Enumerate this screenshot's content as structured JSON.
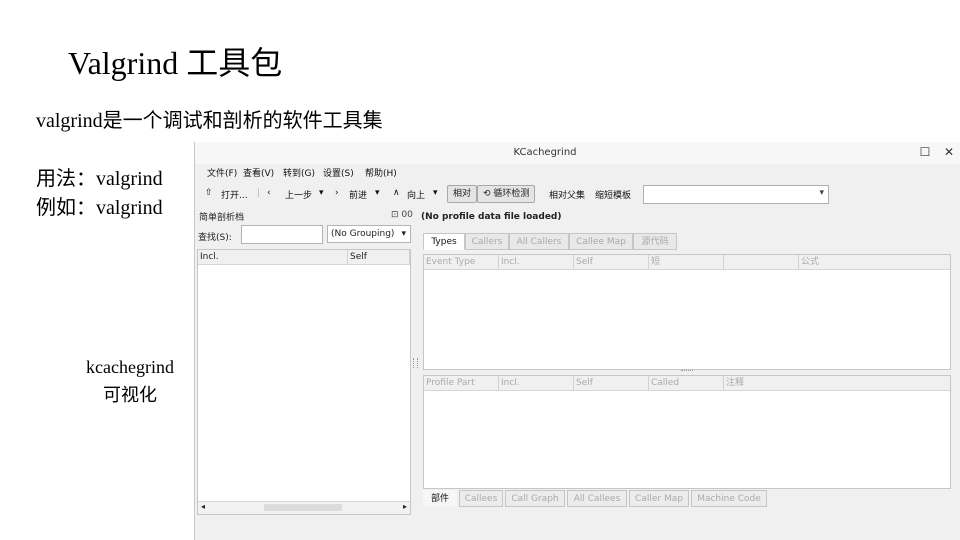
{
  "slide": {
    "title": "Valgrind 工具包",
    "intro": "valgrind是一个调试和剖析的软件工具集",
    "usage": "用法：valgrind",
    "example": "例如：valgrind",
    "caption_line1": "kcachegrind",
    "caption_line2": "可视化"
  },
  "window": {
    "title": "KCachegrind",
    "maximize_glyph": "☐",
    "close_glyph": "✕"
  },
  "menu": [
    "文件(F)",
    "查看(V)",
    "转到(G)",
    "设置(S)",
    "帮助(H)"
  ],
  "toolbar": {
    "open": "打开...",
    "back": "上一步",
    "forward": "前进",
    "up": "向上",
    "relative": "相对",
    "cycle_detection": "循环检测",
    "relative_to_parent": "相对父集",
    "shorten_templates": "缩短模板",
    "event_select": ""
  },
  "left_panel": {
    "title": "简单剖析档",
    "title_right": "⊡ 00",
    "search_label": "查找(S):",
    "search_value": "",
    "grouping": "(No Grouping)",
    "columns": [
      "Incl.",
      "Self"
    ]
  },
  "right_panel": {
    "status": "(No profile data file loaded)",
    "top_tabs": [
      {
        "label": "Types",
        "active": true
      },
      {
        "label": "Callers",
        "active": false
      },
      {
        "label": "All Callers",
        "active": false
      },
      {
        "label": "Callee Map",
        "active": false
      },
      {
        "label": "源代码",
        "active": false
      }
    ],
    "top_columns": [
      "Event Type",
      "Incl.",
      "Self",
      "短",
      "",
      "公式"
    ],
    "bottom_columns": [
      "Profile Part",
      "Incl.",
      "Self",
      "Called",
      "注释"
    ],
    "bottom_tabs": [
      {
        "label": "部件",
        "active": true
      },
      {
        "label": "Callees",
        "active": false
      },
      {
        "label": "Call Graph",
        "active": false
      },
      {
        "label": "All Callees",
        "active": false
      },
      {
        "label": "Caller Map",
        "active": false
      },
      {
        "label": "Machine Code",
        "active": false
      }
    ]
  }
}
